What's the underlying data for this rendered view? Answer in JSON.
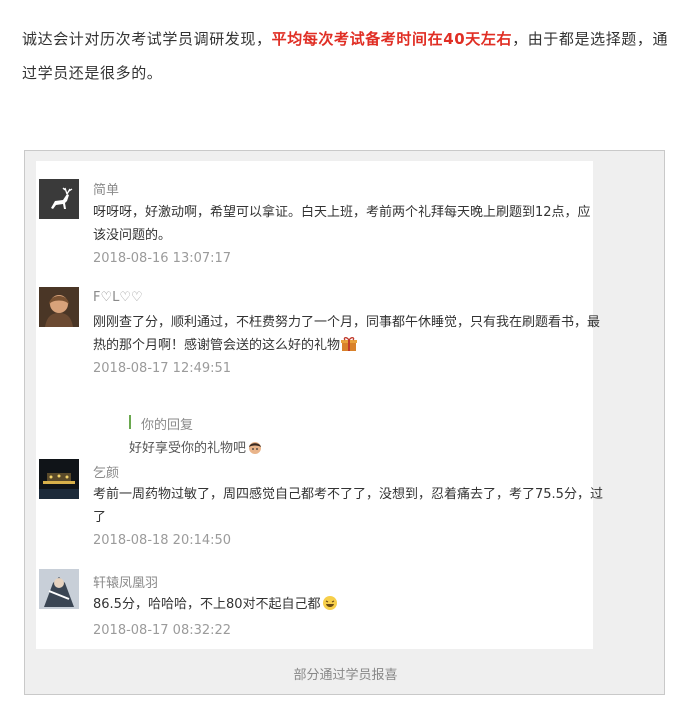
{
  "intro": {
    "part1": "诚达会计对历次考试学员调研发现，",
    "highlight": "平均每次考试备考时间在40天左右",
    "part2": "，由于都是选择题，通过学员还是很多的。"
  },
  "comments": [
    {
      "name": "简单",
      "text": "呀呀呀，好激动啊，希望可以拿证。白天上班，考前两个礼拜每天晚上刷题到12点，应该没问题的。",
      "time": "2018-08-16 13:07:17",
      "avatar_icon": "deer-icon"
    },
    {
      "name": "F♡L",
      "text": "刚刚查了分，顺利通过，不枉费努力了一个月，同事都午休睡觉，只有我在刷题看书，最热的那个月啊！感谢管会送的这么好的礼物",
      "time": "2018-08-17 12:49:51",
      "avatar_icon": "portrait-icon",
      "emoji": "gift-icon"
    },
    {
      "name": "乞颜",
      "text": "考前一周药物过敏了，周四感觉自己都考不了了，没想到，忍着痛去了，考了75.5分，过了",
      "time": "2018-08-18 20:14:50",
      "avatar_icon": "night-scene-icon"
    },
    {
      "name": "轩辕凤凰羽",
      "text": "86.5分，哈哈哈，不上80对不起自己都",
      "time": "2018-08-17 08:32:22",
      "avatar_icon": "character-icon",
      "emoji": "laugh-icon"
    }
  ],
  "reply": {
    "label": "你的回复",
    "text": "好好享受你的礼物吧"
  },
  "caption": "部分通过学员报喜",
  "colors": {
    "highlight": "#e02e24",
    "reply_bar": "#6aa84f"
  }
}
